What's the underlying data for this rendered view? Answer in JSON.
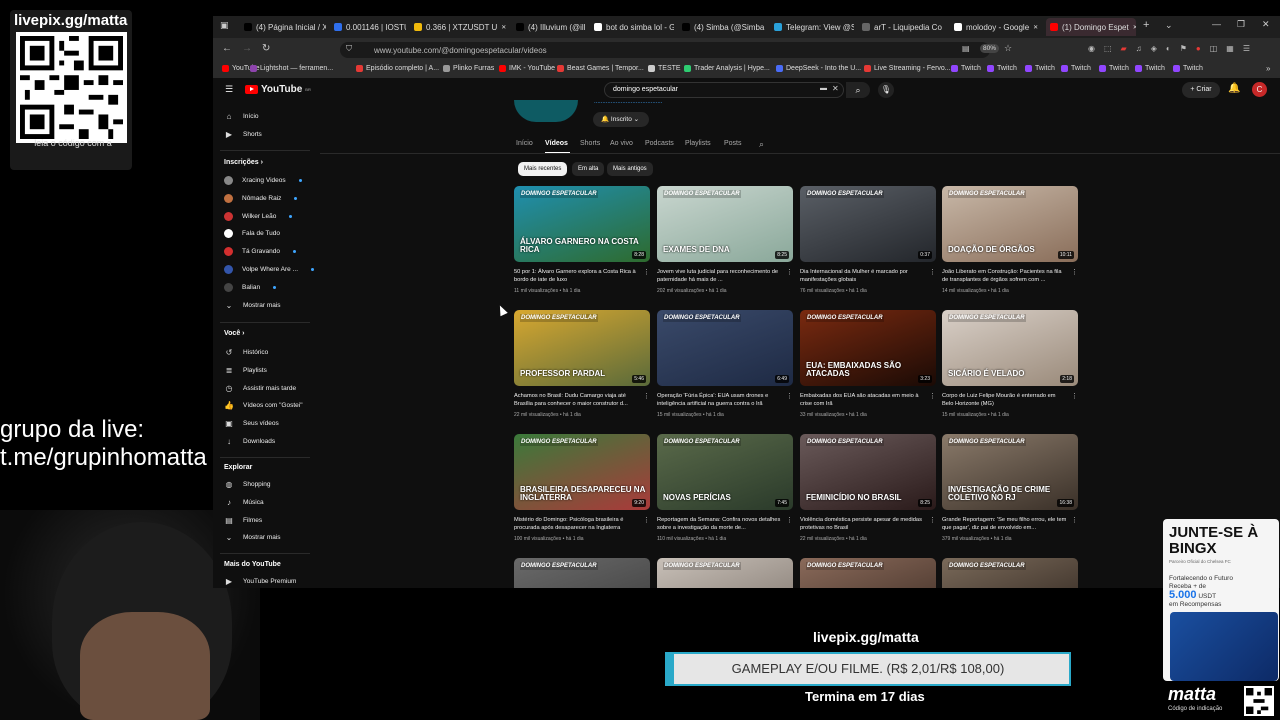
{
  "overlay": {
    "qr_title": "livepix.gg/matta",
    "qr_caption": "leia o código com a",
    "grupo_line1": "grupo da live:",
    "grupo_line2": "t.me/grupinhomatta",
    "livepix_label": "livepix.gg/matta",
    "goal_text": "GAMEPLAY E/OU FILME. (R$ 2,01/R$ 108,00)",
    "goal_progress": 0.0186,
    "ends_text": "Termina em 17 dias",
    "ad": {
      "title": "JUNTE-SE À BINGX",
      "subtitle": "Parceiro Oficial do Chelsea FC",
      "line1": "Fortalecendo o Futuro",
      "line2": "Receba + de",
      "amount": "5.000",
      "unit": "USDT",
      "line3": "em Recompensas"
    },
    "matta_logo": "matta",
    "matta_sub": "Código de indicação"
  },
  "browser": {
    "tabs": [
      {
        "label": "(4) Página Inicial / X",
        "color": "#000000"
      },
      {
        "label": "0.001146 | IOSTUSI",
        "color": "#2f6fed"
      },
      {
        "label": "0.366 | XTZUSDT U",
        "color": "#f0b90b"
      },
      {
        "label": "(4) Illuvium (@illuvi",
        "color": "#000000"
      },
      {
        "label": "bot do simba lol - G",
        "color": "#ffffff"
      },
      {
        "label": "(4) Simba (@Simba",
        "color": "#000000"
      },
      {
        "label": "Telegram: View @Si",
        "color": "#2aa1da"
      },
      {
        "label": "arT - Liquipedia Co",
        "color": "#666666"
      },
      {
        "label": "molodoy - Google",
        "color": "#ffffff"
      },
      {
        "label": "(1) Domingo Espet",
        "color": "#ff0000"
      }
    ],
    "url": "www.youtube.com/@domingoespetacular/videos",
    "zoom": "80%",
    "bookmarks": [
      {
        "label": "YouTube",
        "color": "#ff0000"
      },
      {
        "label": "Lightshot — ferramen...",
        "color": "#8e44ad"
      },
      {
        "label": "Episódio completo | A...",
        "color": "#e53935"
      },
      {
        "label": "Plinko Furras",
        "color": "#999999"
      },
      {
        "label": "IMK - YouTube",
        "color": "#ff0000"
      },
      {
        "label": "Beast Games | Tempor...",
        "color": "#e53935"
      },
      {
        "label": "TESTE",
        "color": "#cccccc"
      },
      {
        "label": "Trader Analysis | Hype...",
        "color": "#2ecc71"
      },
      {
        "label": "DeepSeek - Into the U...",
        "color": "#4a6cf7"
      },
      {
        "label": "Live Streaming - Fervo...",
        "color": "#e53935"
      },
      {
        "label": "Twitch",
        "color": "#9146ff"
      },
      {
        "label": "Twitch",
        "color": "#9146ff"
      },
      {
        "label": "Twitch",
        "color": "#9146ff"
      },
      {
        "label": "Twitch",
        "color": "#9146ff"
      },
      {
        "label": "Twitch",
        "color": "#9146ff"
      },
      {
        "label": "Twitch",
        "color": "#9146ff"
      },
      {
        "label": "Twitch",
        "color": "#9146ff"
      }
    ]
  },
  "youtube": {
    "logo": "YouTube",
    "logo_country": "BR",
    "search_value": "domingo espetacular",
    "criar_label": "+ Criar",
    "avatar_letter": "C",
    "sidebar": {
      "top": [
        {
          "label": "Início",
          "icon": "home-icon",
          "glyph": "⌂"
        },
        {
          "label": "Shorts",
          "icon": "shorts-icon",
          "glyph": "▶"
        }
      ],
      "subs_heading": "Inscrições  ›",
      "subs": [
        {
          "label": "Xracing Videos",
          "color": "#888888",
          "live": true
        },
        {
          "label": "Nômade Raiz",
          "color": "#c07040",
          "live": true
        },
        {
          "label": "Wilker Leão",
          "color": "#cc3333",
          "live": true
        },
        {
          "label": "Fala de Tudo",
          "color": "#ffffff",
          "live": false
        },
        {
          "label": "Tá Gravando",
          "color": "#d32f2f",
          "live": true
        },
        {
          "label": "Volpe Where Are ...",
          "color": "#3355aa",
          "live": true
        },
        {
          "label": "Balian",
          "color": "#444444",
          "live": true
        }
      ],
      "mostrar_mais": "Mostrar mais",
      "voce_heading": "Você  ›",
      "voce": [
        {
          "label": "Histórico",
          "icon": "history-icon",
          "glyph": "↺"
        },
        {
          "label": "Playlists",
          "icon": "playlists-icon",
          "glyph": "≣"
        },
        {
          "label": "Assistir mais tarde",
          "icon": "clock-icon",
          "glyph": "◷"
        },
        {
          "label": "Vídeos com \"Gostei\"",
          "icon": "like-icon",
          "glyph": "👍"
        },
        {
          "label": "Seus vídeos",
          "icon": "your-videos-icon",
          "glyph": "▣"
        },
        {
          "label": "Downloads",
          "icon": "download-icon",
          "glyph": "↓"
        }
      ],
      "explorar_heading": "Explorar",
      "explorar": [
        {
          "label": "Shopping",
          "icon": "shopping-icon",
          "glyph": "◍"
        },
        {
          "label": "Música",
          "icon": "music-icon",
          "glyph": "♪"
        },
        {
          "label": "Filmes",
          "icon": "film-icon",
          "glyph": "▤"
        },
        {
          "label": "Mostrar mais",
          "icon": "chevron-down-icon",
          "glyph": "⌄"
        }
      ],
      "mais_heading": "Mais do YouTube",
      "mais": [
        {
          "label": "YouTube Premium",
          "icon": "premium-icon",
          "glyph": "▶"
        }
      ]
    },
    "channel": {
      "inscrito_label": "Inscrito"
    },
    "channel_tabs": [
      "Início",
      "Vídeos",
      "Shorts",
      "Ao vivo",
      "Podcasts",
      "Playlists",
      "Posts"
    ],
    "active_tab": "Vídeos",
    "chips": [
      "Mais recentes",
      "Em alta",
      "Mais antigos"
    ],
    "brand": "DOMINGO ESPETACULAR",
    "videos": [
      {
        "title": "50 por 1: Álvaro Garnero explora a Costa Rica à bordo de iate de luxo",
        "meta": "11 mil visualizações • há 1 dia",
        "caption": "ÁLVARO GARNERO NA COSTA RICA",
        "duration": "8:28",
        "c1": "#1f8fb0",
        "c2": "#2e6b2e"
      },
      {
        "title": "Jovem vive luta judicial para reconhecimento de paternidade há mais de ...",
        "meta": "202 mil visualizações • há 1 dia",
        "caption": "EXAMES DE DNA",
        "duration": "8:25",
        "c1": "#c9d6cf",
        "c2": "#8aa89a"
      },
      {
        "title": "Dia Internacional da Mulher é marcado por manifestações globais",
        "meta": "76 mil visualizações • há 1 dia",
        "caption": "",
        "duration": "0:37",
        "c1": "#5a5f66",
        "c2": "#23262b"
      },
      {
        "title": "João Liberato em Construção: Pacientes na fila de transplantes de órgãos sofrem com ...",
        "meta": "14 mil visualizações • há 1 dia",
        "caption": "DOAÇÃO DE ÓRGÃOS",
        "duration": "10:11",
        "c1": "#c8b8a8",
        "c2": "#8a6e5a"
      },
      {
        "title": "Achamos no Brasil: Dudu Camargo viaja até Brasília para conhecer o maior construtor d...",
        "meta": "22 mil visualizações • há 1 dia",
        "caption": "PROFESSOR PARDAL",
        "duration": "5:46",
        "c1": "#d8a830",
        "c2": "#5a6a3a"
      },
      {
        "title": "Operação 'Fúria Épica': EUA usam drones e inteligência artificial na guerra contra o Irã",
        "meta": "15 mil visualizações • há 1 dia",
        "caption": "",
        "duration": "6:49",
        "c1": "#3a4a6a",
        "c2": "#1e2a44"
      },
      {
        "title": "Embaixadas dos EUA são atacadas em meio à crise com Irã",
        "meta": "33 mil visualizações • há 1 dia",
        "caption": "EUA: EMBAIXADAS SÃO ATACADAS",
        "duration": "3:23",
        "c1": "#7a2a10",
        "c2": "#1a0a05"
      },
      {
        "title": "Corpo de Luiz Felipe Mourão é enterrado em Belo Horizonte (MG)",
        "meta": "15 mil visualizações • há 1 dia",
        "caption": "SICÁRIO É VELADO",
        "duration": "2:18",
        "c1": "#d9d0c8",
        "c2": "#9a8a7a"
      },
      {
        "title": "Mistério do Domingo: Psicóloga brasileira é procurada após desaparecer na Inglaterra",
        "meta": "100 mil visualizações • há 1 dia",
        "caption": "BRASILEIRA DESAPARECEU NA INGLATERRA",
        "duration": "9:20",
        "c1": "#3a7a3a",
        "c2": "#aa3a3a"
      },
      {
        "title": "Reportagem da Semana: Confira novos detalhes sobre a investigação da morte de...",
        "meta": "110 mil visualizações • há 1 dia",
        "caption": "NOVAS PERÍCIAS",
        "duration": "7:45",
        "c1": "#5a6a4a",
        "c2": "#2a3a2a"
      },
      {
        "title": "Violência doméstica persiste apesar de medidas protetivas no Brasil",
        "meta": "22 mil visualizações • há 1 dia",
        "caption": "FEMINICÍDIO NO BRASIL",
        "duration": "8:25",
        "c1": "#6a5a5a",
        "c2": "#2a1a1a"
      },
      {
        "title": "Grande Reportagem: 'Se meu filho errou, ele tem que pagar', diz pai de envolvido em...",
        "meta": "379 mil visualizações • há 1 dia",
        "caption": "INVESTIGAÇÃO DE CRIME COLETIVO NO RJ",
        "duration": "16:38",
        "c1": "#8a7a6a",
        "c2": "#3a3028"
      },
      {
        "title": "",
        "meta": "",
        "caption": "",
        "duration": "",
        "c1": "#6a6a6a",
        "c2": "#3a3a3a"
      },
      {
        "title": "",
        "meta": "",
        "caption": "",
        "duration": "",
        "c1": "#c8c0b8",
        "c2": "#7a7068"
      },
      {
        "title": "",
        "meta": "",
        "caption": "",
        "duration": "",
        "c1": "#8a6a5a",
        "c2": "#3a2a22"
      },
      {
        "title": "",
        "meta": "",
        "caption": "",
        "duration": "",
        "c1": "#7a6a5a",
        "c2": "#2a201a"
      }
    ]
  }
}
